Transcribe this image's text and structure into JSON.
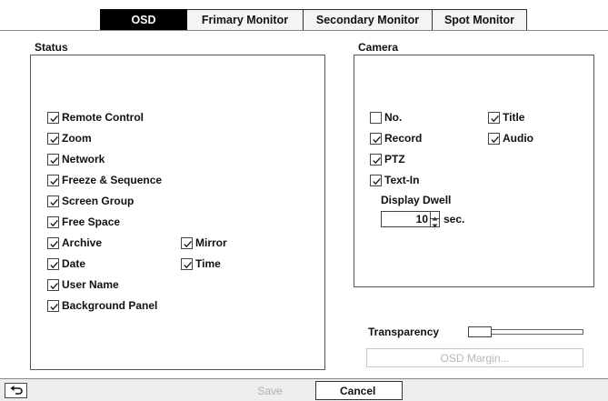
{
  "tabs": [
    {
      "label": "OSD",
      "active": true
    },
    {
      "label": "Frimary Monitor",
      "active": false
    },
    {
      "label": "Secondary Monitor",
      "active": false
    },
    {
      "label": "Spot Monitor",
      "active": false
    }
  ],
  "status": {
    "title": "Status",
    "items": [
      {
        "label": "Remote Control",
        "checked": true
      },
      {
        "label": "Zoom",
        "checked": true
      },
      {
        "label": "Network",
        "checked": true
      },
      {
        "label": "Freeze & Sequence",
        "checked": true
      },
      {
        "label": "Screen Group",
        "checked": true
      },
      {
        "label": "Free Space",
        "checked": true
      },
      {
        "label": "Archive",
        "checked": true
      },
      {
        "label": "Mirror",
        "checked": true
      },
      {
        "label": "Date",
        "checked": true
      },
      {
        "label": "Time",
        "checked": true
      },
      {
        "label": "User Name",
        "checked": true
      },
      {
        "label": "Background Panel",
        "checked": true
      }
    ]
  },
  "camera": {
    "title": "Camera",
    "items": [
      {
        "label": "No.",
        "checked": false
      },
      {
        "label": "Title",
        "checked": true
      },
      {
        "label": "Record",
        "checked": true
      },
      {
        "label": "Audio",
        "checked": true
      },
      {
        "label": "PTZ",
        "checked": true
      },
      {
        "label": "Text-In",
        "checked": true
      }
    ],
    "dwell_label": "Display Dwell",
    "dwell_value": "10",
    "dwell_unit": "sec."
  },
  "transparency": {
    "label": "Transparency",
    "value_fraction": 0.0
  },
  "osd_margin_label": "OSD Margin...",
  "footer": {
    "back_icon": "return-arrow-icon",
    "save_label": "Save",
    "cancel_label": "Cancel"
  }
}
